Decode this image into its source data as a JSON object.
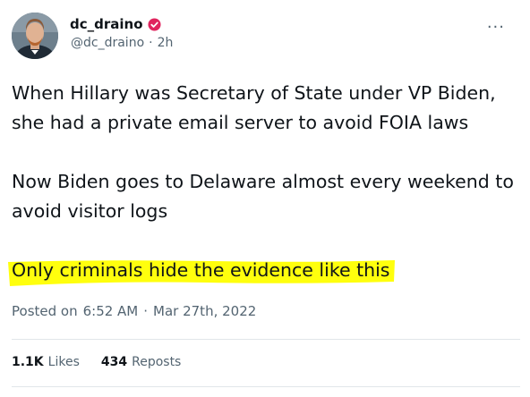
{
  "author": {
    "display_name": "dc_draino",
    "handle": "@dc_draino",
    "separator": "·",
    "age": "2h",
    "badge_color": "#e0245e"
  },
  "menu": {
    "more_label": "···"
  },
  "post": {
    "paragraphs": [
      "When Hillary was Secretary of State under VP Biden, she had a private email server to avoid FOIA laws",
      "Now Biden goes to Delaware almost every weekend to avoid visitor logs"
    ],
    "highlighted": "Only criminals hide the evidence like this",
    "highlight_color": "#ffff00"
  },
  "timestamp": {
    "prefix": "Posted on",
    "time": "6:52 AM",
    "separator": "·",
    "date": "Mar 27th, 2022"
  },
  "stats": {
    "likes_count": "1.1K",
    "likes_label": "Likes",
    "reposts_count": "434",
    "reposts_label": "Reposts"
  }
}
